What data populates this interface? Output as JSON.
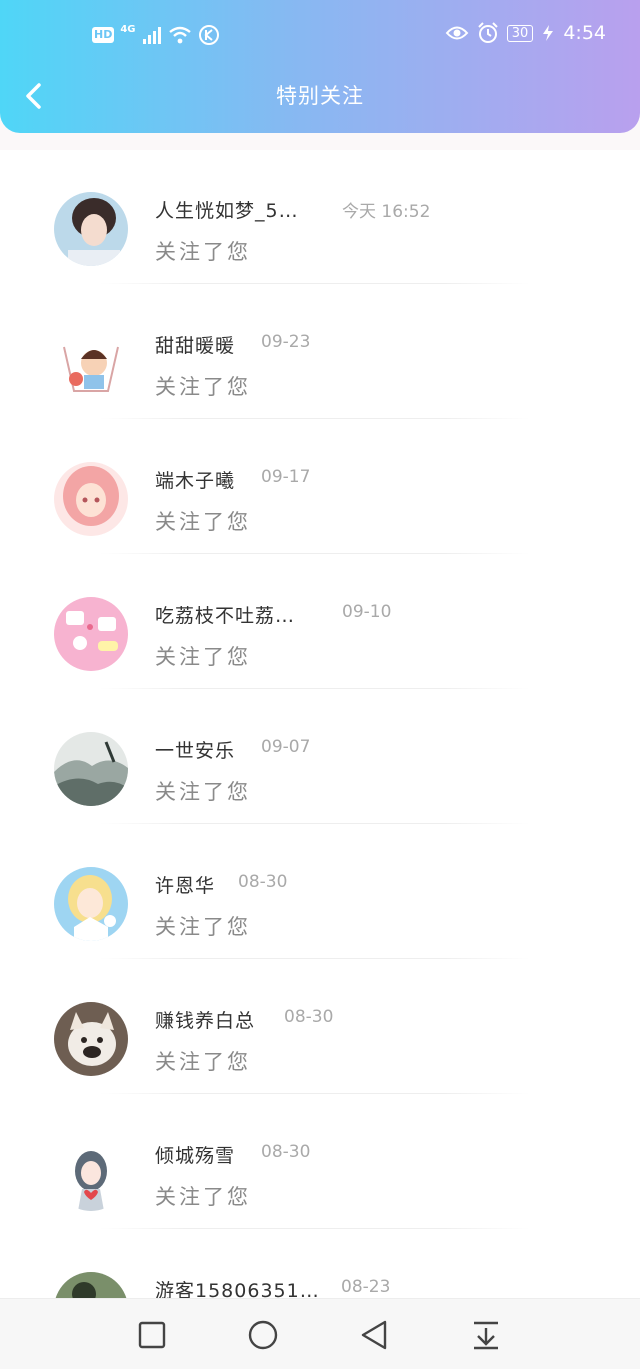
{
  "status_bar": {
    "hd": "HD",
    "network": "4G",
    "battery": "30",
    "time": "4:54",
    "icons": [
      "signal-icon",
      "wifi-icon",
      "k-circle-icon",
      "eye-icon",
      "alarm-icon",
      "charging-icon"
    ]
  },
  "header": {
    "title": "特别关注",
    "back_icon": "chevron-left-icon",
    "gradient": [
      "#4fd6f7",
      "#b9a0ee"
    ]
  },
  "notifications": [
    {
      "name": "人生恍如梦_5…",
      "date": "今天 16:52",
      "action": "关注了您",
      "avatar": "avatar-woman-portrait"
    },
    {
      "name": "甜甜暖暖",
      "date": "09-23",
      "action": "关注了您",
      "avatar": "avatar-cartoon-girl"
    },
    {
      "name": "端木子曦",
      "date": "09-17",
      "action": "关注了您",
      "avatar": "avatar-anime-pink-hair"
    },
    {
      "name": "吃荔枝不吐荔…",
      "date": "09-10",
      "action": "关注了您",
      "avatar": "avatar-pink-stickers"
    },
    {
      "name": "一世安乐",
      "date": "09-07",
      "action": "关注了您",
      "avatar": "avatar-ink-landscape"
    },
    {
      "name": "许恩华",
      "date": "08-30",
      "action": "关注了您",
      "avatar": "avatar-anime-blonde"
    },
    {
      "name": "赚钱养白总",
      "date": "08-30",
      "action": "关注了您",
      "avatar": "avatar-french-bulldog"
    },
    {
      "name": "倾城殇雪",
      "date": "08-30",
      "action": "关注了您",
      "avatar": "avatar-anime-heart"
    },
    {
      "name": "游客15806351…",
      "date": "08-23",
      "action": "",
      "avatar": "avatar-landscape-photo"
    }
  ],
  "nav_bar": {
    "buttons": [
      "square-icon",
      "circle-icon",
      "back-triangle-icon",
      "download-arrow-icon"
    ]
  }
}
